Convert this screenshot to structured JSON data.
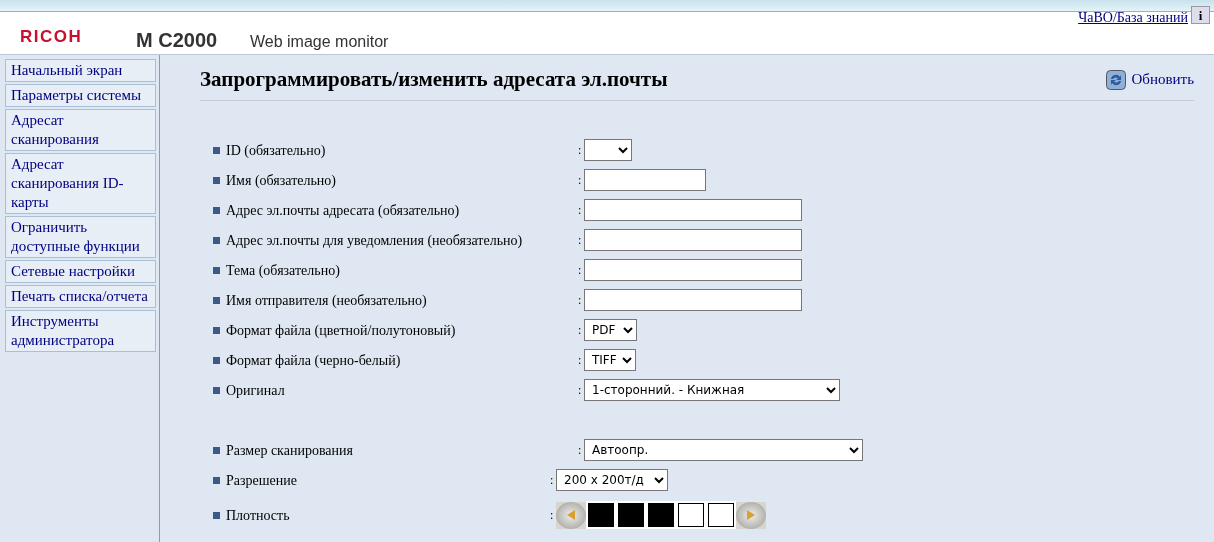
{
  "header": {
    "brand": "RICOH",
    "model": "M C2000",
    "product": "Web image monitor",
    "help_link": "ЧаВО/База знаний",
    "info_button": "i"
  },
  "sidebar": {
    "items": [
      {
        "label": "Начальный экран",
        "selected": false
      },
      {
        "label": "Параметры системы",
        "selected": false
      },
      {
        "label": "Адресат сканирования",
        "selected": false
      },
      {
        "label": "Адресат сканирования ID-карты",
        "selected": false
      },
      {
        "label": "Ограничить доступные функции",
        "selected": false
      },
      {
        "label": "Сетевые настройки",
        "selected": false
      },
      {
        "label": "Печать списка/отчета",
        "selected": false
      },
      {
        "label": "Инструменты администратора",
        "selected": false
      }
    ]
  },
  "page": {
    "title": "Запрограммировать/изменить адресата эл.почты",
    "refresh": "Обновить"
  },
  "form": {
    "separator": ":",
    "fields": [
      {
        "label": "ID (обязательно)",
        "kind": "select"
      },
      {
        "label": "Имя (обязательно)",
        "kind": "text"
      },
      {
        "label": "Адрес эл.почты адресата (обязательно)",
        "kind": "text"
      },
      {
        "label": "Адрес эл.почты для уведомления (необязательно)",
        "kind": "text"
      },
      {
        "label": "Тема (обязательно)",
        "kind": "text"
      },
      {
        "label": "Имя отправителя (необязательно)",
        "kind": "text"
      },
      {
        "label": "Формат файла (цветной/полутоновый)",
        "kind": "select",
        "value": "PDF"
      },
      {
        "label": "Формат файла (черно-белый)",
        "kind": "select",
        "value": "TIFF"
      },
      {
        "label": "Оригинал",
        "kind": "select",
        "value": "1-сторонний. - Книжная"
      },
      {
        "label": "Размер сканирования",
        "kind": "select",
        "value": "Автоопр."
      },
      {
        "label": "Разрешение",
        "kind": "select",
        "value": "200 x 200т/д"
      },
      {
        "label": "Плотность",
        "kind": "density",
        "stars": 3
      }
    ]
  }
}
